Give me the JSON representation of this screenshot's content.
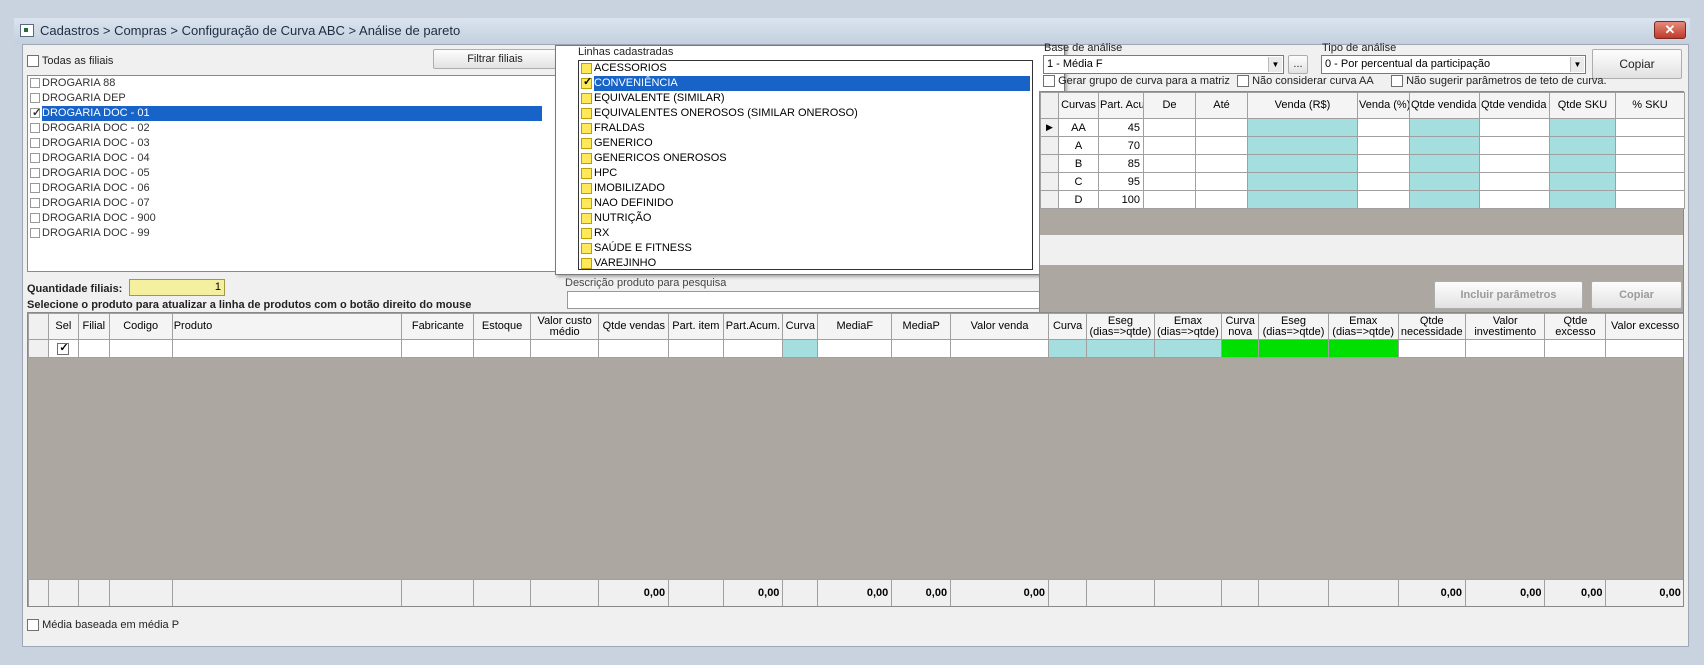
{
  "window": {
    "title": "Cadastros > Compras > Configuração de Curva ABC > Análise de pareto",
    "close_icon": "close-icon"
  },
  "branches": {
    "all_label": "Todas as filiais",
    "filter_button": "Filtrar filiais",
    "qty_label": "Quantidade filiais:",
    "qty_value": "1",
    "items": [
      {
        "label": "DROGARIA 88",
        "checked": false,
        "selected": false
      },
      {
        "label": "DROGARIA DEP",
        "checked": false,
        "selected": false
      },
      {
        "label": "DROGARIA DOC - 01",
        "checked": true,
        "selected": true
      },
      {
        "label": "DROGARIA DOC - 02",
        "checked": false,
        "selected": false
      },
      {
        "label": "DROGARIA DOC - 03",
        "checked": false,
        "selected": false
      },
      {
        "label": "DROGARIA DOC - 04",
        "checked": false,
        "selected": false
      },
      {
        "label": "DROGARIA DOC - 05",
        "checked": false,
        "selected": false
      },
      {
        "label": "DROGARIA DOC - 06",
        "checked": false,
        "selected": false
      },
      {
        "label": "DROGARIA DOC - 07",
        "checked": false,
        "selected": false
      },
      {
        "label": "DROGARIA DOC - 900",
        "checked": false,
        "selected": false
      },
      {
        "label": "DROGARIA DOC - 99",
        "checked": false,
        "selected": false
      }
    ]
  },
  "lines": {
    "label": "Linhas cadastradas",
    "search_label": "Descrição produto para pesquisa",
    "search_value": "",
    "items": [
      {
        "label": "ACESSORIOS",
        "checked": false,
        "selected": false
      },
      {
        "label": "CONVENIÊNCIA",
        "checked": true,
        "selected": true
      },
      {
        "label": "EQUIVALENTE (SIMILAR)",
        "checked": false,
        "selected": false
      },
      {
        "label": "EQUIVALENTES ONEROSOS (SIMILAR ONEROSO)",
        "checked": false,
        "selected": false
      },
      {
        "label": "FRALDAS",
        "checked": false,
        "selected": false
      },
      {
        "label": "GENERICO",
        "checked": false,
        "selected": false
      },
      {
        "label": "GENERICOS ONEROSOS",
        "checked": false,
        "selected": false
      },
      {
        "label": "HPC",
        "checked": false,
        "selected": false
      },
      {
        "label": "IMOBILIZADO",
        "checked": false,
        "selected": false
      },
      {
        "label": "NAO DEFINIDO",
        "checked": false,
        "selected": false
      },
      {
        "label": "NUTRIÇÃO",
        "checked": false,
        "selected": false
      },
      {
        "label": "RX",
        "checked": false,
        "selected": false
      },
      {
        "label": "SAÚDE E FITNESS",
        "checked": false,
        "selected": false
      },
      {
        "label": "VAREJINHO",
        "checked": false,
        "selected": false
      }
    ]
  },
  "analysis": {
    "base_label": "Base de análise",
    "base_value": "1 - Média F",
    "dots_button": "...",
    "type_label": "Tipo de análise",
    "type_value": "0 - Por percentual da participação",
    "copy_button": "Copiar",
    "opt_group": "Gerar grupo de curva para a matriz",
    "opt_no_aa": "Não considerar curva AA",
    "opt_no_suggest": "Não sugerir parâmetros de teto de curva."
  },
  "curves": {
    "headers": [
      "Curvas",
      "Part. Acum.",
      "De",
      "Até",
      "Venda (R$)",
      "Venda (%)",
      "Qtde vendida (un)",
      "Qtde vendida (%)",
      "Qtde SKU",
      "% SKU"
    ],
    "rows": [
      {
        "curve": "AA",
        "part": "45"
      },
      {
        "curve": "A",
        "part": "70"
      },
      {
        "curve": "B",
        "part": "85"
      },
      {
        "curve": "C",
        "part": "95"
      },
      {
        "curve": "D",
        "part": "100"
      }
    ]
  },
  "instructions": "Selecione o produto para atualizar a linha de produtos com o botão direito do mouse",
  "buttons": {
    "include": "Incluir parâmetros",
    "copy2": "Copiar"
  },
  "products": {
    "headers": [
      "Sel",
      "Filial",
      "Codigo",
      "Produto",
      "Fabricante",
      "Estoque",
      "Valor custo médio",
      "Qtde vendas",
      "Part. item",
      "Part.Acum.",
      "Curva",
      "MediaF",
      "MediaP",
      "Valor venda",
      "Curva",
      "Eseg (dias=>qtde)",
      "Emax (dias=>qtde)",
      "Curva nova",
      "Eseg (dias=>qtde)",
      "Emax (dias=>qtde)",
      "Qtde necessidade",
      "Valor investimento",
      "Qtde excesso",
      "Valor excesso"
    ],
    "totals": [
      "",
      "",
      "",
      "",
      "",
      "",
      "",
      "0,00",
      "",
      "0,00",
      "",
      "0,00",
      "0,00",
      "0,00",
      "",
      "",
      "",
      "",
      "",
      "",
      "0,00",
      "0,00",
      "0,00",
      "0,00"
    ]
  },
  "footer": {
    "media_label": "Média baseada em média P"
  },
  "colors": {
    "selection": "#1763c8",
    "cyan": "#a4dede",
    "green": "#00e000",
    "grid_bg": "#aca7a0"
  }
}
